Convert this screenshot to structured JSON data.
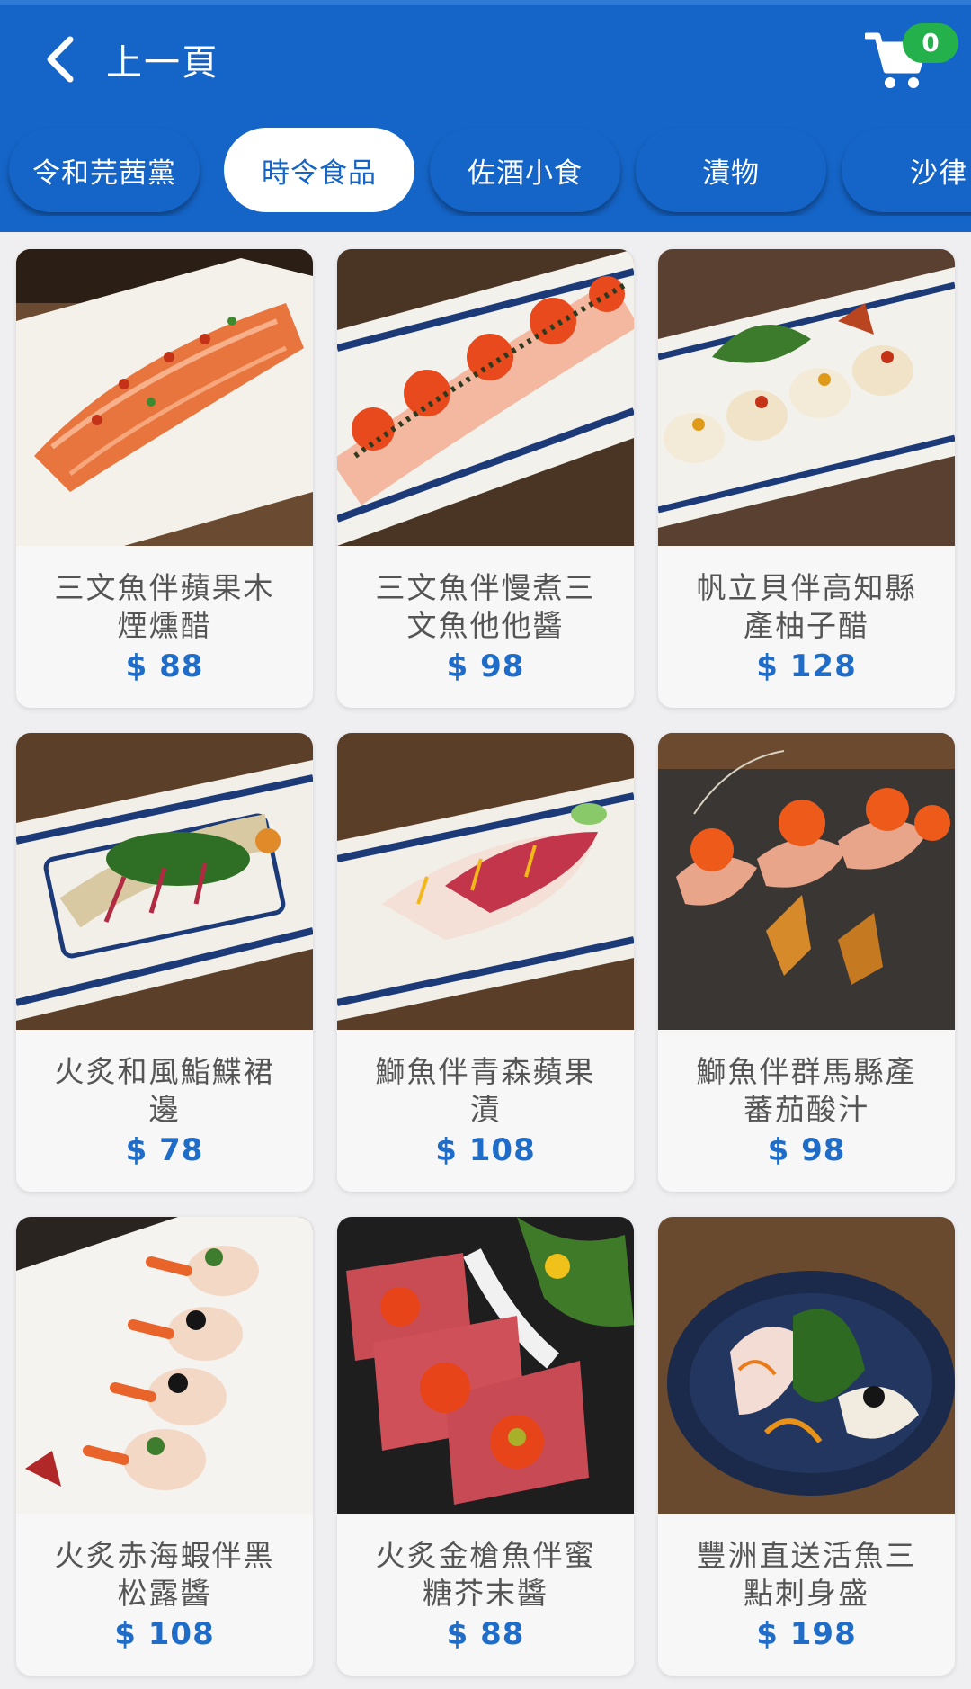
{
  "header": {
    "back_label": "上一頁",
    "back_icon": "chevron-left-icon",
    "cart_icon": "cart-icon",
    "cart_count": "0",
    "colors": {
      "bar": "#1565c8",
      "badge": "#24b04a",
      "price": "#1f6cc9"
    }
  },
  "tabs": [
    {
      "label": "令和芫茜黨",
      "active": false
    },
    {
      "label": "時令食品",
      "active": true
    },
    {
      "label": "佐酒小食",
      "active": false
    },
    {
      "label": "漬物",
      "active": false
    },
    {
      "label": "沙律",
      "active": false
    }
  ],
  "items": [
    {
      "name": "三文魚伴蘋果木煙燻醋",
      "price": "$ 88",
      "image": "salmon-sashimi-photo"
    },
    {
      "name": "三文魚伴慢煮三文魚他他醬",
      "price": "$ 98",
      "image": "salmon-roe-roll-photo"
    },
    {
      "name": "帆立貝伴高知縣產柚子醋",
      "price": "$ 128",
      "image": "scallop-photo"
    },
    {
      "name": "火炙和風鮨鰈裙邊",
      "price": "$ 78",
      "image": "flounder-fin-photo"
    },
    {
      "name": "鰤魚伴青森蘋果漬",
      "price": "$ 108",
      "image": "yellowtail-apple-photo"
    },
    {
      "name": "鰤魚伴群馬縣產蕃茄酸汁",
      "price": "$ 98",
      "image": "yellowtail-tomato-photo"
    },
    {
      "name": "火炙赤海蝦伴黑松露醬",
      "price": "$ 108",
      "image": "red-shrimp-photo"
    },
    {
      "name": "火炙金槍魚伴蜜糖芥末醬",
      "price": "$ 88",
      "image": "tuna-tataki-photo"
    },
    {
      "name": "豐洲直送活魚三點刺身盛",
      "price": "$ 198",
      "image": "sashimi-platter-photo"
    }
  ]
}
